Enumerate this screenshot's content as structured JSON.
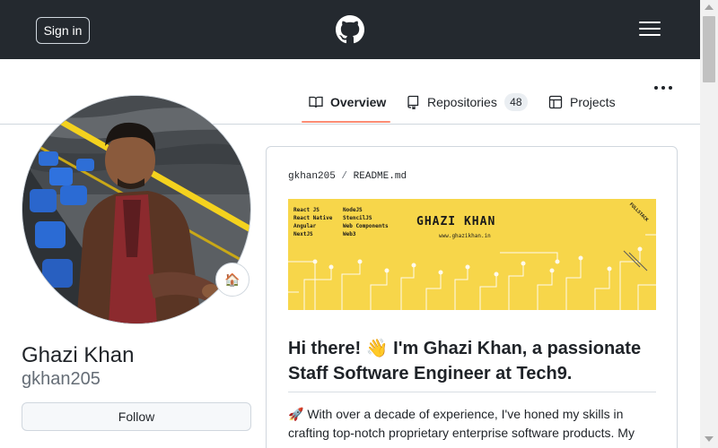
{
  "header": {
    "signin_label": "Sign in"
  },
  "tabs": [
    {
      "label": "Overview",
      "icon": "book-icon",
      "active": true
    },
    {
      "label": "Repositories",
      "icon": "repo-icon",
      "count": "48"
    },
    {
      "label": "Projects",
      "icon": "table-icon"
    }
  ],
  "profile": {
    "name": "Ghazi Khan",
    "login": "gkhan205",
    "status_emoji": "🏠",
    "follow_label": "Follow"
  },
  "readme": {
    "owner": "gkhan205",
    "separator": "/",
    "file": "README.md",
    "banner": {
      "skills_col1": [
        "React JS",
        "React Native",
        "Angular",
        "NextJS"
      ],
      "skills_col2": [
        "NodeJS",
        "StencilJS",
        "Web Components",
        "Web3"
      ],
      "name": "GHAZI KHAN",
      "site": "www.ghazikhan.in",
      "tag": "FULLSTACK"
    },
    "heading": "Hi there! 👋 I'm Ghazi Khan, a passionate Staff Software Engineer at Tech9.",
    "paragraph": "🚀 With over a decade of experience, I've honed my skills in crafting top-notch proprietary enterprise software products. My"
  },
  "colors": {
    "header_bg": "#24292f",
    "tab_underline": "#fd8c73",
    "banner_bg": "#f7d64a",
    "border": "#d0d7de"
  }
}
